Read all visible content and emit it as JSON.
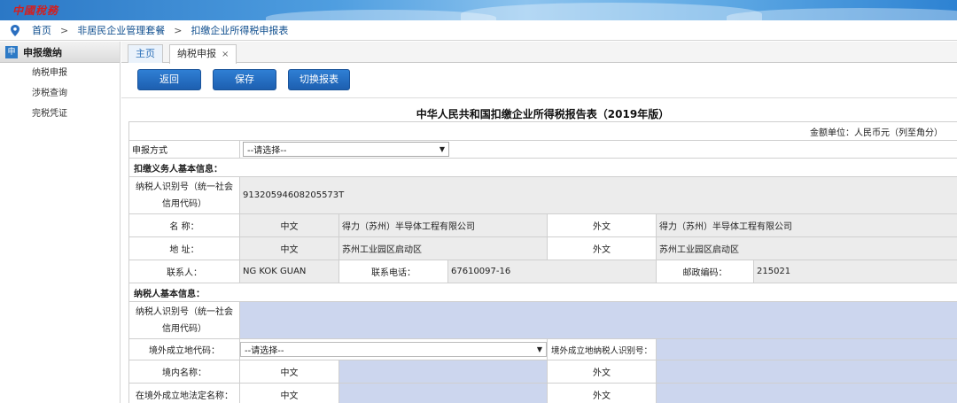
{
  "banner": {
    "logo_text": "中國稅務"
  },
  "breadcrumb": {
    "home": "首页",
    "level1": "非居民企业管理套餐",
    "level2": "扣缴企业所得税申报表",
    "sep": ">"
  },
  "sidebar": {
    "header_badge": "申",
    "header": "申报缴纳",
    "items": [
      {
        "label": "纳税申报"
      },
      {
        "label": "涉税查询"
      },
      {
        "label": "完税凭证"
      }
    ]
  },
  "tabs": [
    {
      "label": "主页"
    },
    {
      "label": "纳税申报",
      "close": "×"
    }
  ],
  "toolbar": {
    "back": "返回",
    "save": "保存",
    "switch": "切换报表"
  },
  "form": {
    "title": "中华人民共和国扣缴企业所得税报告表（2019年版）",
    "unit": "金额单位：人民币元（列至角分）",
    "declare_method_label": "申报方式",
    "declare_method_value": "--请选择--",
    "withholder_section": "扣缴义务人基本信息：",
    "taxpayer_id_label": "纳税人识别号（统一社会信用代码）",
    "taxpayer_id_value": "91320594608205573T",
    "name_label": "名  称：",
    "chinese": "中文",
    "foreign": "外文",
    "name_cn": "得力（苏州）半导体工程有限公司",
    "name_foreign": "得力（苏州）半导体工程有限公司",
    "address_label": "地  址：",
    "address_cn": "苏州工业园区启动区",
    "address_foreign": "苏州工业园区启动区",
    "contact_label": "联系人：",
    "contact_value": "NG KOK GUAN",
    "phone_label": "联系电话：",
    "phone_value": "67610097-16",
    "zip_label": "邮政编码：",
    "zip_value": "215021",
    "taxpayer_section": "纳税人基本信息：",
    "taxpayer_id2_label": "纳税人识别号（统一社会信用代码）",
    "overseas_code_label": "境外成立地代码：",
    "overseas_code_value": "--请选择--",
    "overseas_taxid_label": "境外成立地纳税人识别号：",
    "domestic_name_label": "境内名称：",
    "overseas_legal_name_label": "在境外成立地法定名称："
  }
}
